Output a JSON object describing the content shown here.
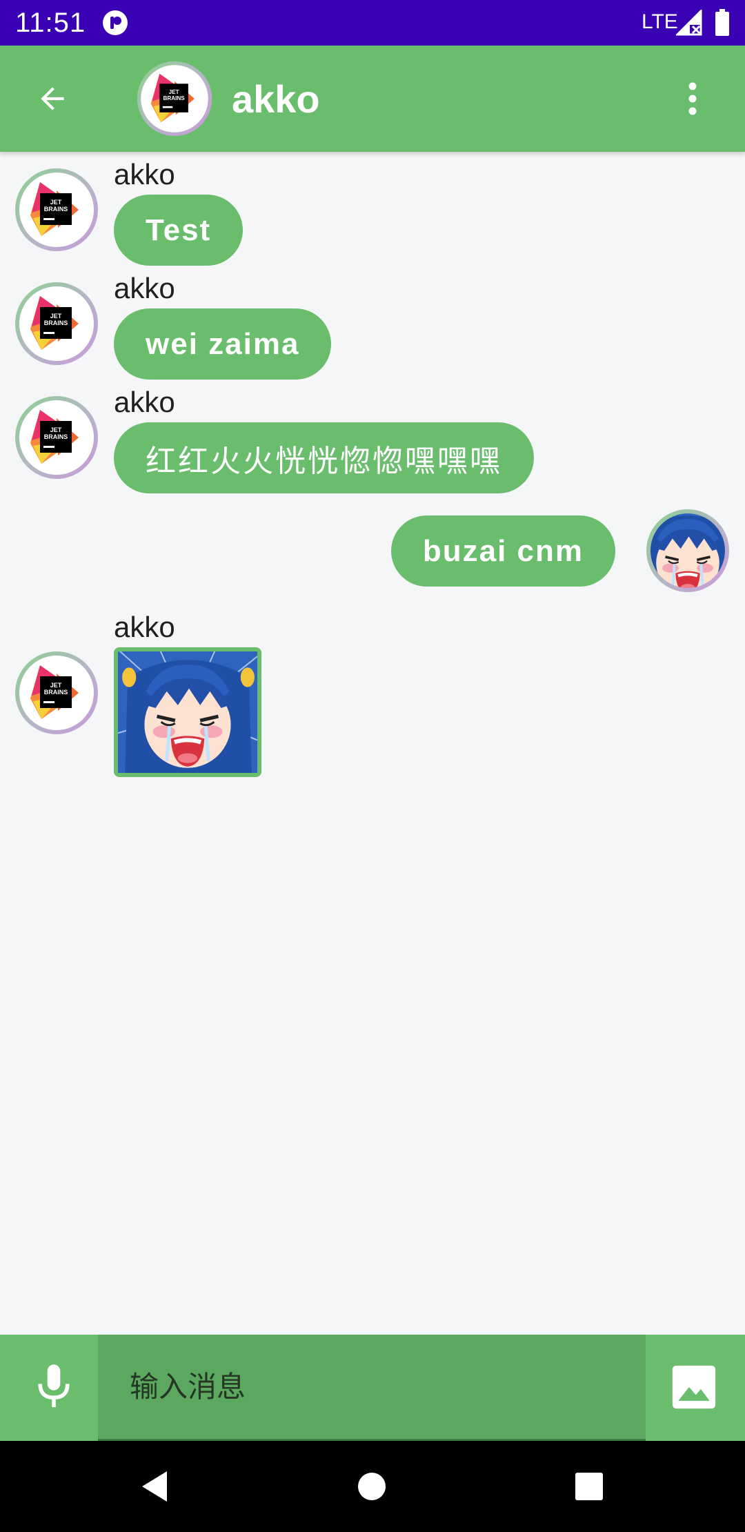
{
  "status_bar": {
    "time": "11:51",
    "network": "LTE",
    "icons": [
      "app-notification-icon",
      "signal-icon",
      "battery-icon"
    ]
  },
  "header": {
    "title": "akko",
    "icons": [
      "back-arrow-icon",
      "more-vert-icon"
    ]
  },
  "messages": [
    {
      "sender": "akko",
      "text": "Test",
      "side": "left",
      "type": "text"
    },
    {
      "sender": "akko",
      "text": "wei zaima",
      "side": "left",
      "type": "text"
    },
    {
      "sender": "akko",
      "text": "红红火火恍恍惚惚嘿嘿嘿",
      "side": "left",
      "type": "text"
    },
    {
      "sender": "",
      "text": "buzai cnm",
      "side": "right",
      "type": "text"
    },
    {
      "sender": "akko",
      "text": "",
      "side": "left",
      "type": "image"
    }
  ],
  "input_bar": {
    "placeholder": "输入消息",
    "icons": [
      "mic-icon",
      "image-icon"
    ]
  },
  "nav_bar": {
    "icons": [
      "nav-back-icon",
      "nav-home-icon",
      "nav-recents-icon"
    ]
  },
  "colors": {
    "status_bar": "#3a00b4",
    "accent_green": "#69bd6c",
    "input_field": "#5ca85f",
    "background": "#f5f6f8"
  }
}
